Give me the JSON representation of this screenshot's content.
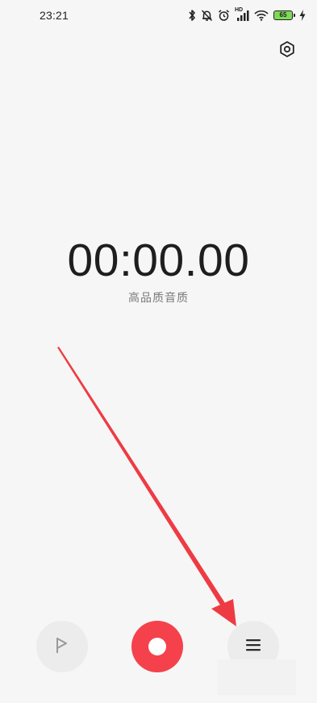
{
  "status_bar": {
    "time": "23:21",
    "battery_level": "65",
    "network_label": "HD",
    "icons": [
      "bluetooth-icon",
      "mute-bell-icon",
      "alarm-icon",
      "hd-signal-icon",
      "wifi-icon",
      "battery-icon",
      "charging-icon"
    ]
  },
  "toolbar": {
    "settings_icon": "gear-icon"
  },
  "recorder": {
    "elapsed_time": "00:00.00",
    "quality_label": "高品质音质"
  },
  "controls": {
    "flag_icon": "flag-icon",
    "record_icon": "record-icon",
    "list_icon": "list-icon"
  },
  "colors": {
    "background": "#f6f6f6",
    "record_red": "#f5414b",
    "annotation_arrow": "#ee3b43",
    "battery_green": "#7ed957"
  }
}
